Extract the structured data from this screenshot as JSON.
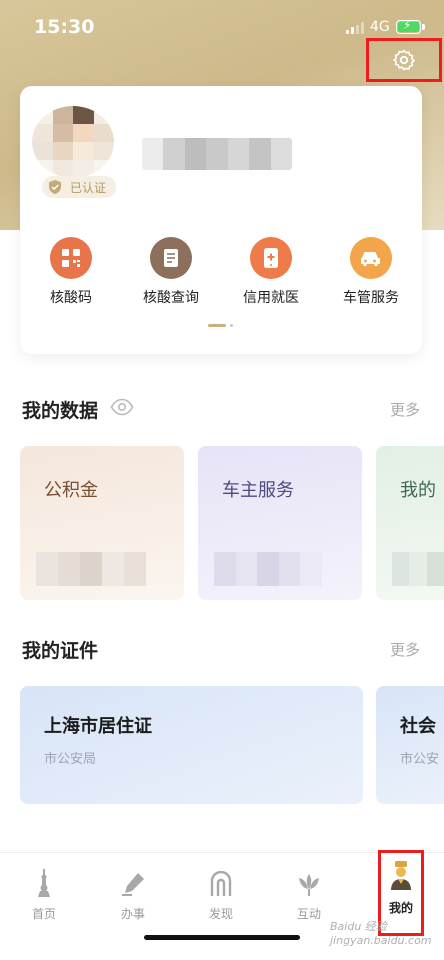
{
  "status_bar": {
    "time": "15:30",
    "network": "4G"
  },
  "profile": {
    "verified_label": "已认证",
    "services": [
      {
        "label": "核酸码",
        "icon": "qr-code-icon",
        "color": "#e8744a"
      },
      {
        "label": "核酸查询",
        "icon": "document-icon",
        "color": "#8e6f5c"
      },
      {
        "label": "信用就医",
        "icon": "phone-medical-icon",
        "color": "#ef7a4a"
      },
      {
        "label": "车管服务",
        "icon": "car-icon",
        "color": "#f2a54a"
      }
    ]
  },
  "my_data": {
    "title": "我的数据",
    "more": "更多",
    "cards": [
      {
        "label": "公积金",
        "color": "#7a4e33"
      },
      {
        "label": "车主服务",
        "color": "#4e4a7e"
      },
      {
        "label": "我的",
        "color": "#3f6a4c"
      }
    ]
  },
  "my_certificates": {
    "title": "我的证件",
    "more": "更多",
    "cards": [
      {
        "title": "上海市居住证",
        "issuer": "市公安局"
      },
      {
        "title": "社会",
        "issuer": "市公安"
      }
    ]
  },
  "tabs": [
    {
      "label": "首页",
      "icon": "tower-icon"
    },
    {
      "label": "办事",
      "icon": "pen-icon"
    },
    {
      "label": "发现",
      "icon": "arch-icon"
    },
    {
      "label": "互动",
      "icon": "lotus-icon"
    },
    {
      "label": "我的",
      "icon": "profile-icon",
      "active": true
    }
  ],
  "watermark": "Baidu 经验 jingyan.baidu.com",
  "colors": {
    "annotation_red": "#ee1d1d",
    "gold": "#c8b180",
    "tab_active": "#222222"
  }
}
